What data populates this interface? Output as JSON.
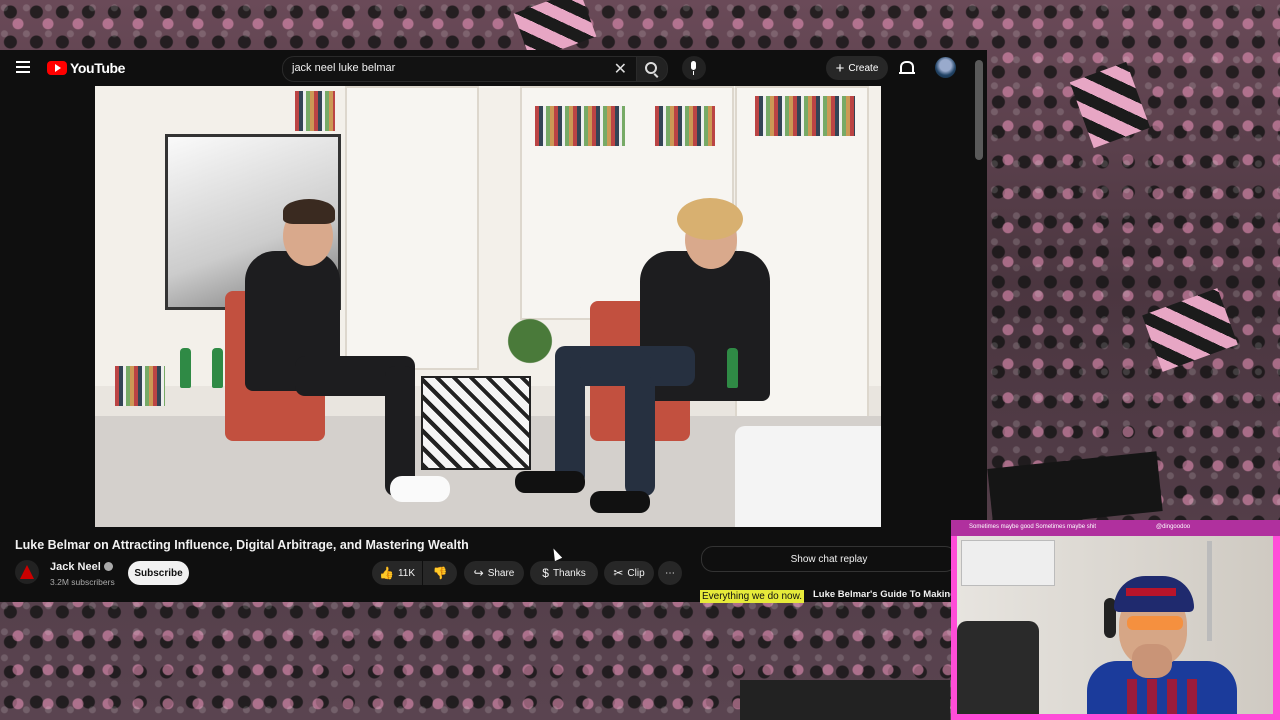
{
  "youtube": {
    "logo_text": "YouTube",
    "search_value": "jack neel luke belmar",
    "create_label": "Create",
    "video_title": "Luke Belmar on Attracting Influence, Digital Arbitrage, and Mastering Wealth",
    "channel_name": "Jack Neel",
    "subscribers": "3.2M subscribers",
    "subscribe_label": "Subscribe",
    "like_count": "11K",
    "share_label": "Share",
    "thanks_label": "Thanks",
    "clip_label": "Clip",
    "more_label": "⋯",
    "chat_replay_label": "Show chat replay",
    "next_badge": "Everything we do now.",
    "next_title": "Luke Belmar's Guide To Making"
  },
  "stream_overlay": {
    "ticker_text": "Sometimes maybe good Sometimes maybe shit",
    "handle": "@dingoodoo"
  },
  "colors": {
    "brand_red": "#ff0000",
    "overlay_pink": "#ff4dd8",
    "badge_yellow": "#e6ea3a"
  }
}
